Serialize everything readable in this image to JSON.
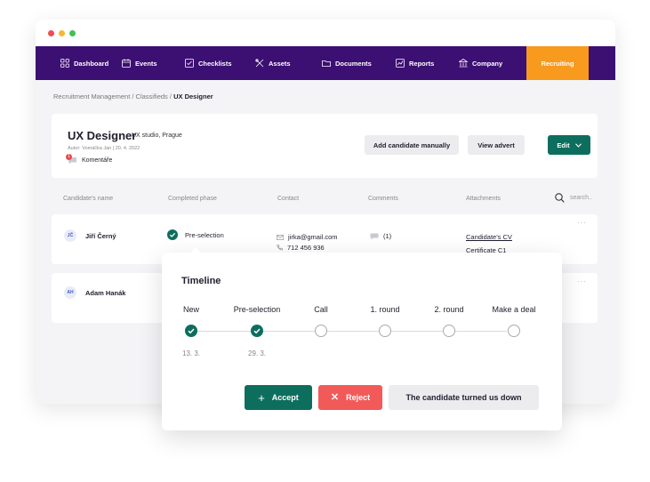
{
  "window": {
    "dots": [
      "#f04e4e",
      "#f7b731",
      "#3fc05a"
    ]
  },
  "nav": {
    "items": [
      {
        "label": "Dashboard",
        "icon": "grid-icon"
      },
      {
        "label": "Events",
        "icon": "calendar-icon"
      },
      {
        "label": "Checklists",
        "icon": "checklist-icon"
      },
      {
        "label": "Assets",
        "icon": "tools-icon"
      },
      {
        "label": "Documents",
        "icon": "folder-icon"
      },
      {
        "label": "Reports",
        "icon": "chart-icon"
      },
      {
        "label": "Company",
        "icon": "bank-icon"
      },
      {
        "label": "Recruiting",
        "icon": ""
      }
    ],
    "active": "Recruiting",
    "bg": "#3c0f73",
    "active_bg": "#f79a1e"
  },
  "breadcrumb": {
    "path": "Recruitment Management / Classifieds / ",
    "current": "UX Designer"
  },
  "job": {
    "title": "UX Designer",
    "company": "UX studio, Prague",
    "meta": "Autor: Vomáčka Jan  |  20. 4. 2022",
    "comments_label": "Komentáře",
    "comments_badge": "1",
    "add_candidate": "Add candidate manually",
    "view_advert": "View advert",
    "edit": "Edit"
  },
  "table": {
    "headers": [
      "Candidate's name",
      "Completed phase",
      "Contact",
      "Comments",
      "Attachments"
    ],
    "search_placeholder": "search..",
    "rows": [
      {
        "initials": "JČ",
        "name": "Jiří Černý",
        "phase": "Pre-selection",
        "email": "jirka@gmail.com",
        "phone": "712 456 936",
        "comments": "(1)",
        "attachments": [
          "Candidate's CV",
          "Certificate C1"
        ],
        "more": "···"
      },
      {
        "initials": "AH",
        "name": "Adam Hanák",
        "more": "···"
      }
    ]
  },
  "timeline": {
    "title": "Timeline",
    "steps": [
      {
        "label": "New",
        "done": true,
        "date": "13. 3."
      },
      {
        "label": "Pre-selection",
        "done": true,
        "date": "29. 3."
      },
      {
        "label": "Call",
        "done": false,
        "date": ""
      },
      {
        "label": "1. round",
        "done": false,
        "date": ""
      },
      {
        "label": "2. round",
        "done": false,
        "date": ""
      },
      {
        "label": "Make a deal",
        "done": false,
        "date": ""
      }
    ],
    "accept": "Accept",
    "reject": "Reject",
    "turned_down": "The candidate turned us down",
    "accent": "#0e6e5e",
    "reject_color": "#f25a5a"
  }
}
